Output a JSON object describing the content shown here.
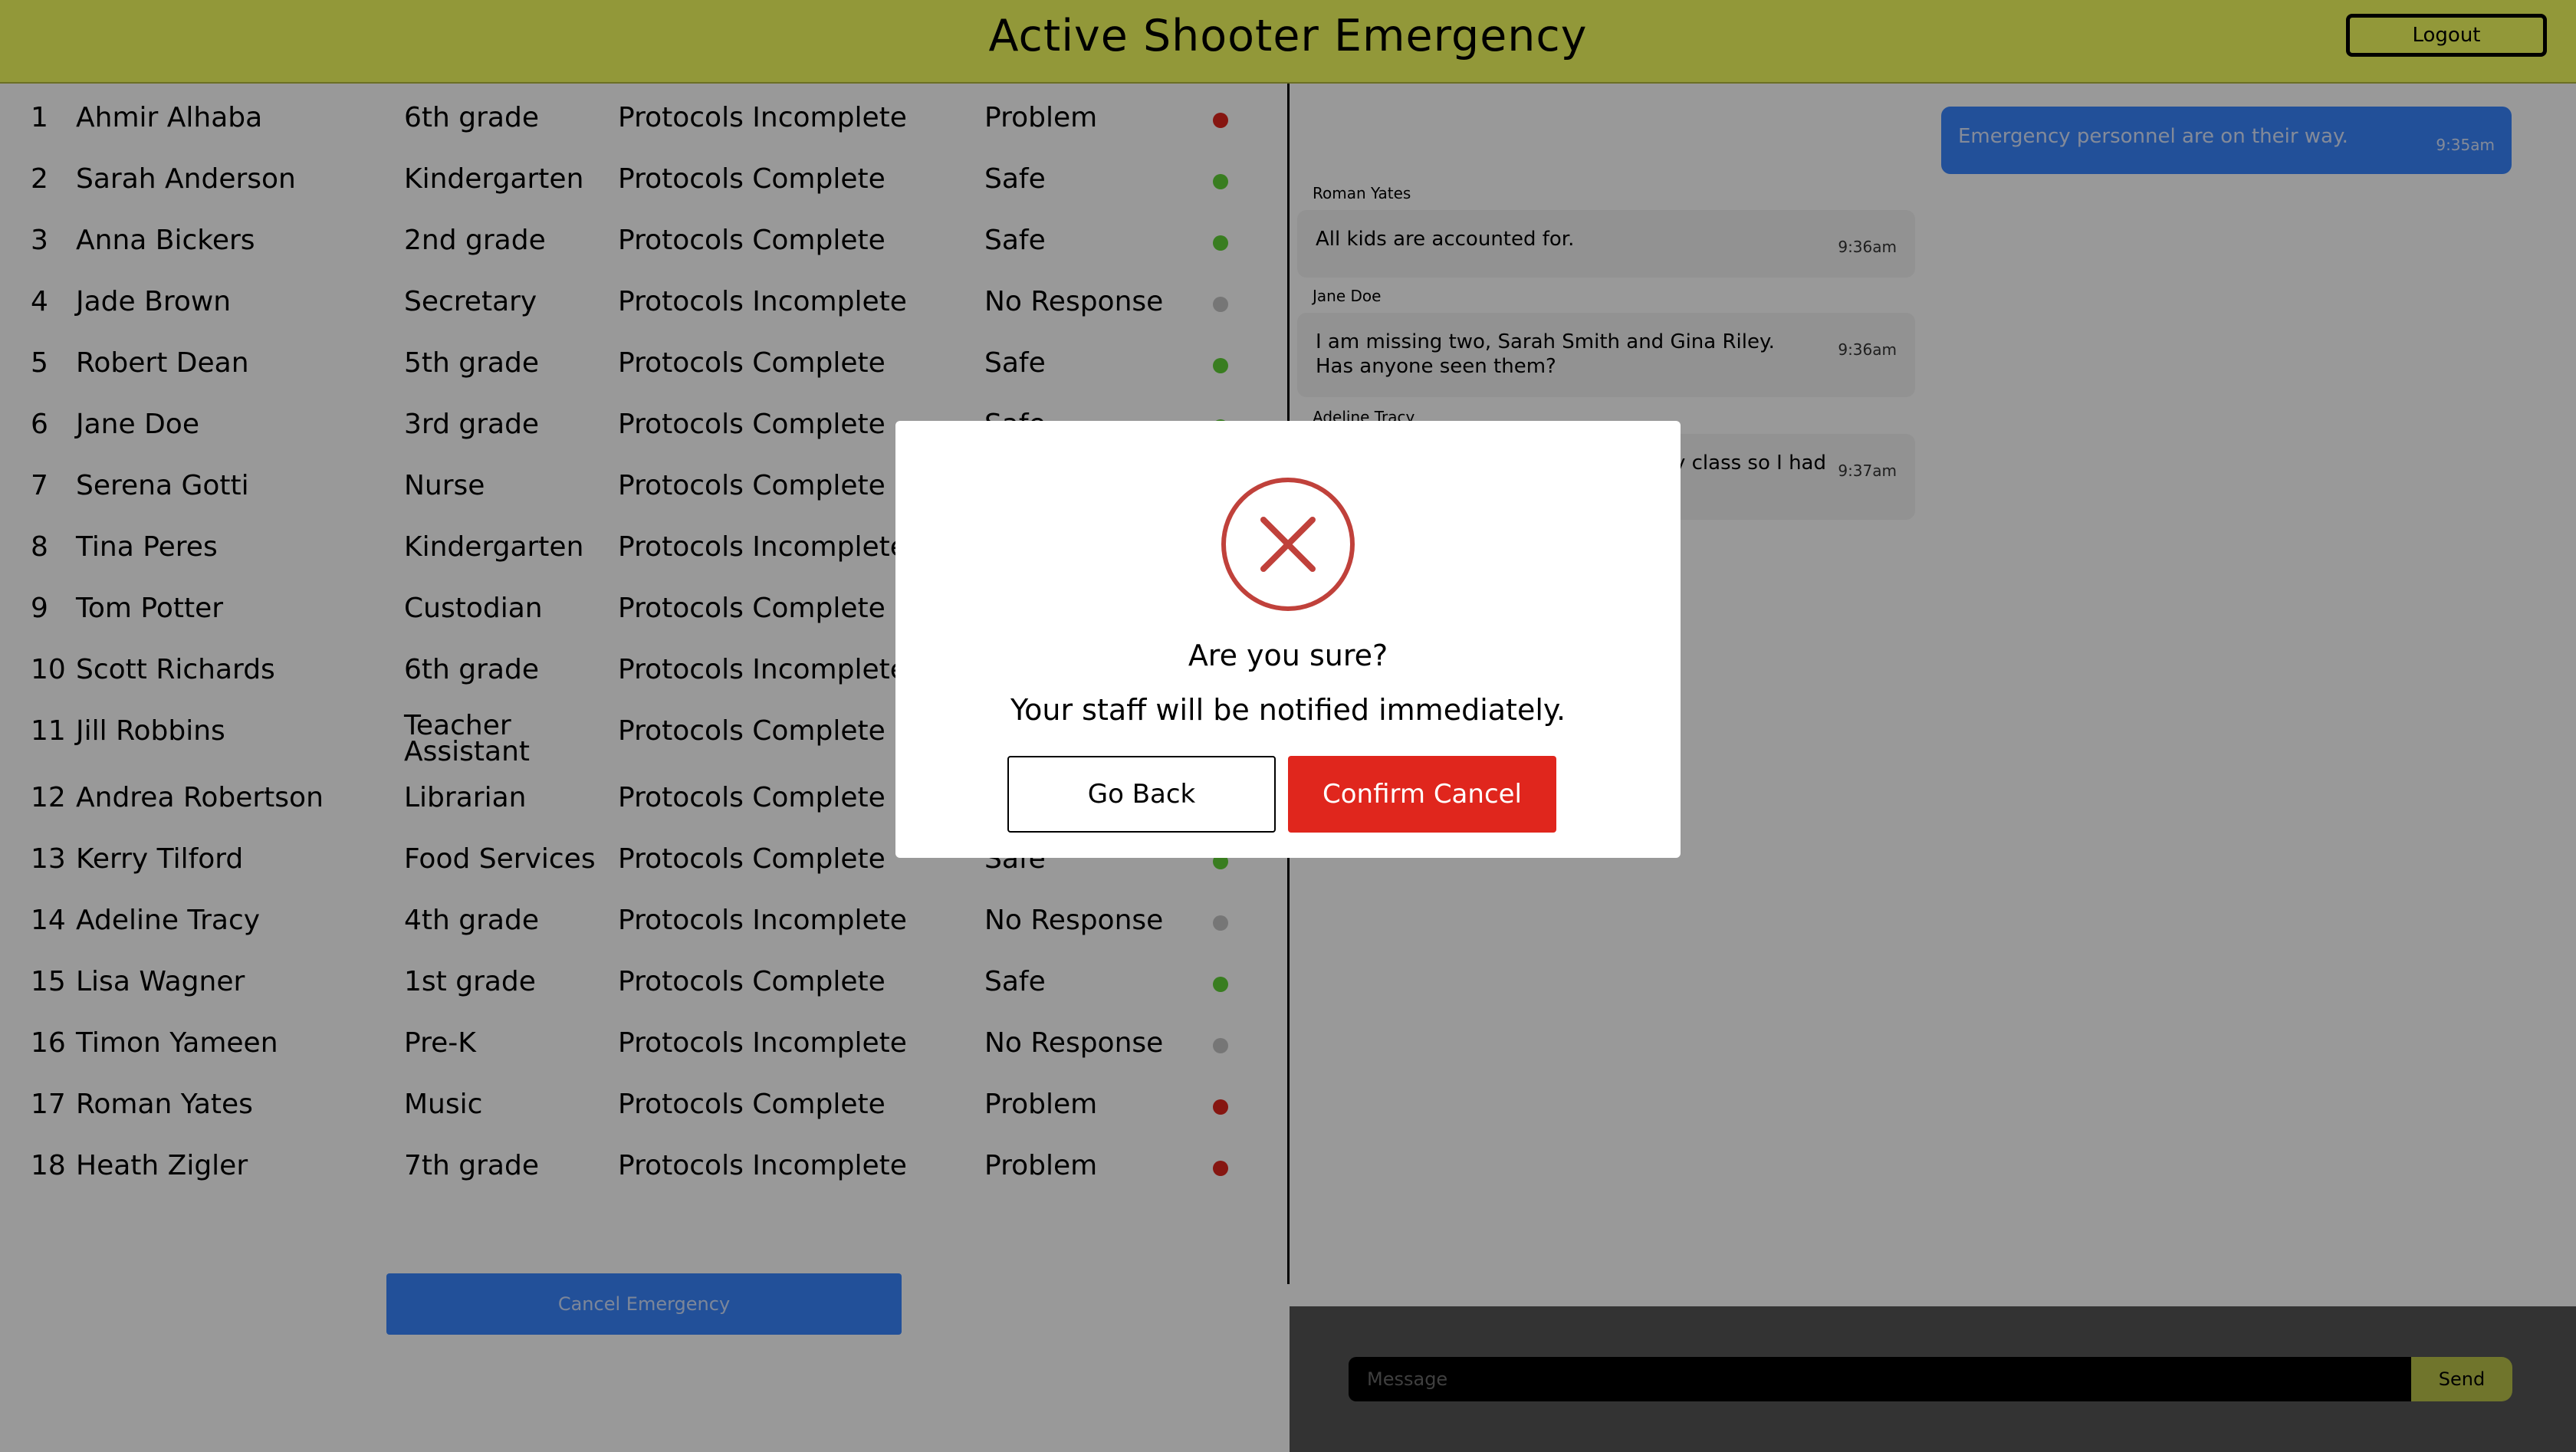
{
  "header": {
    "title": "Active Shooter Emergency",
    "logout_label": "Logout"
  },
  "staff": [
    {
      "num": "1",
      "name": "Ahmir Alhaba",
      "role": "6th grade",
      "protocol": "Protocols Incomplete",
      "status": "Problem",
      "dot": "problem"
    },
    {
      "num": "2",
      "name": "Sarah Anderson",
      "role": "Kindergarten",
      "protocol": "Protocols Complete",
      "status": "Safe",
      "dot": "safe"
    },
    {
      "num": "3",
      "name": "Anna Bickers",
      "role": "2nd grade",
      "protocol": "Protocols Complete",
      "status": "Safe",
      "dot": "safe"
    },
    {
      "num": "4",
      "name": "Jade Brown",
      "role": "Secretary",
      "protocol": "Protocols Incomplete",
      "status": "No Response",
      "dot": "none"
    },
    {
      "num": "5",
      "name": "Robert Dean",
      "role": "5th grade",
      "protocol": "Protocols Complete",
      "status": "Safe",
      "dot": "safe"
    },
    {
      "num": "6",
      "name": "Jane Doe",
      "role": "3rd grade",
      "protocol": "Protocols Complete",
      "status": "Safe",
      "dot": "safe"
    },
    {
      "num": "7",
      "name": "Serena Gotti",
      "role": "Nurse",
      "protocol": "Protocols Complete",
      "status": "",
      "dot": ""
    },
    {
      "num": "8",
      "name": "Tina Peres",
      "role": "Kindergarten",
      "protocol": "Protocols Incomplete",
      "status": "",
      "dot": ""
    },
    {
      "num": "9",
      "name": "Tom Potter",
      "role": "Custodian",
      "protocol": "Protocols Complete",
      "status": "",
      "dot": ""
    },
    {
      "num": "10",
      "name": "Scott Richards",
      "role": "6th grade",
      "protocol": "Protocols Incomplete",
      "status": "",
      "dot": ""
    },
    {
      "num": "11",
      "name": "Jill Robbins",
      "role": "Teacher Assistant",
      "protocol": "Protocols Complete",
      "status": "",
      "dot": ""
    },
    {
      "num": "12",
      "name": "Andrea Robertson",
      "role": "Librarian",
      "protocol": "Protocols Complete",
      "status": "",
      "dot": ""
    },
    {
      "num": "13",
      "name": "Kerry Tilford",
      "role": "Food Services",
      "protocol": "Protocols Complete",
      "status": "Safe",
      "dot": "safe"
    },
    {
      "num": "14",
      "name": "Adeline Tracy",
      "role": "4th grade",
      "protocol": "Protocols Incomplete",
      "status": "No Response",
      "dot": "none"
    },
    {
      "num": "15",
      "name": "Lisa Wagner",
      "role": "1st grade",
      "protocol": "Protocols Complete",
      "status": "Safe",
      "dot": "safe"
    },
    {
      "num": "16",
      "name": "Timon Yameen",
      "role": "Pre-K",
      "protocol": "Protocols Incomplete",
      "status": "No Response",
      "dot": "none"
    },
    {
      "num": "17",
      "name": "Roman Yates",
      "role": "Music",
      "protocol": "Protocols Complete",
      "status": "Problem",
      "dot": "problem"
    },
    {
      "num": "18",
      "name": "Heath Zigler",
      "role": "7th grade",
      "protocol": "Protocols Incomplete",
      "status": "Problem",
      "dot": "problem"
    }
  ],
  "cancel_emergency_label": "Cancel Emergency",
  "chat": {
    "outgoing": {
      "text": "Emergency personnel are on their way.",
      "time": "9:35am"
    },
    "messages": [
      {
        "sender": "Roman Yates",
        "text": "All kids are accounted for.",
        "time": "9:36am"
      },
      {
        "sender": "Jane Doe",
        "text": "I am missing two, Sarah Smith and Gina Riley. Has anyone seen them?",
        "time": "9:36am"
      },
      {
        "sender": "Adeline Tracy",
        "text": "y class so I had",
        "time": "9:37am"
      }
    ],
    "input_placeholder": "Message",
    "send_label": "Send"
  },
  "modal": {
    "title": "Are you sure?",
    "subtitle": "Your staff will be notified immediately.",
    "back_label": "Go Back",
    "confirm_label": "Confirm Cancel",
    "icon": "close-circle-icon"
  },
  "colors": {
    "accent": "#bbc34a",
    "primary": "#3a86ff",
    "danger": "#e0261d",
    "safe": "#5fd136",
    "neutral": "#c5c5c5"
  }
}
